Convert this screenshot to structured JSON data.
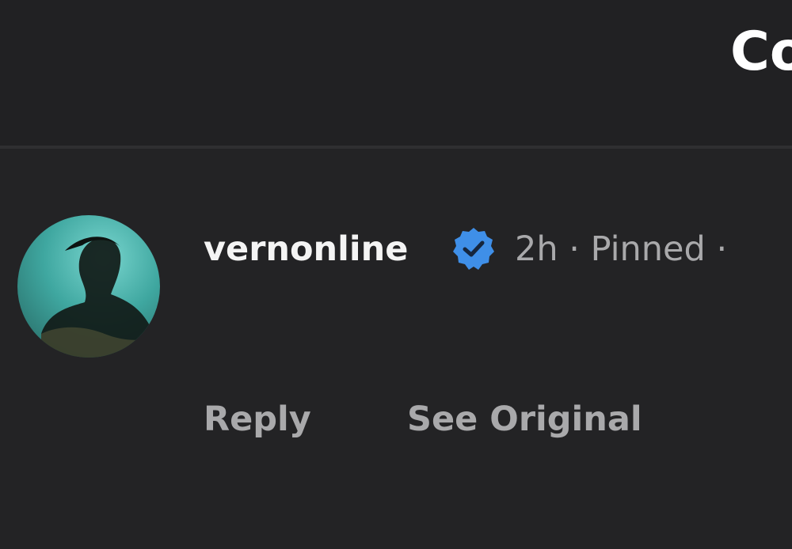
{
  "header": {
    "title": "Co"
  },
  "comment": {
    "avatar_icon": "user-avatar-icon",
    "username": "vernonline",
    "verified_icon": "verified-badge-icon",
    "verified_color": "#3f8fe8",
    "meta": "2h · Pinned ·",
    "text": "",
    "actions": {
      "reply": "Reply",
      "see_original": "See Original"
    }
  }
}
